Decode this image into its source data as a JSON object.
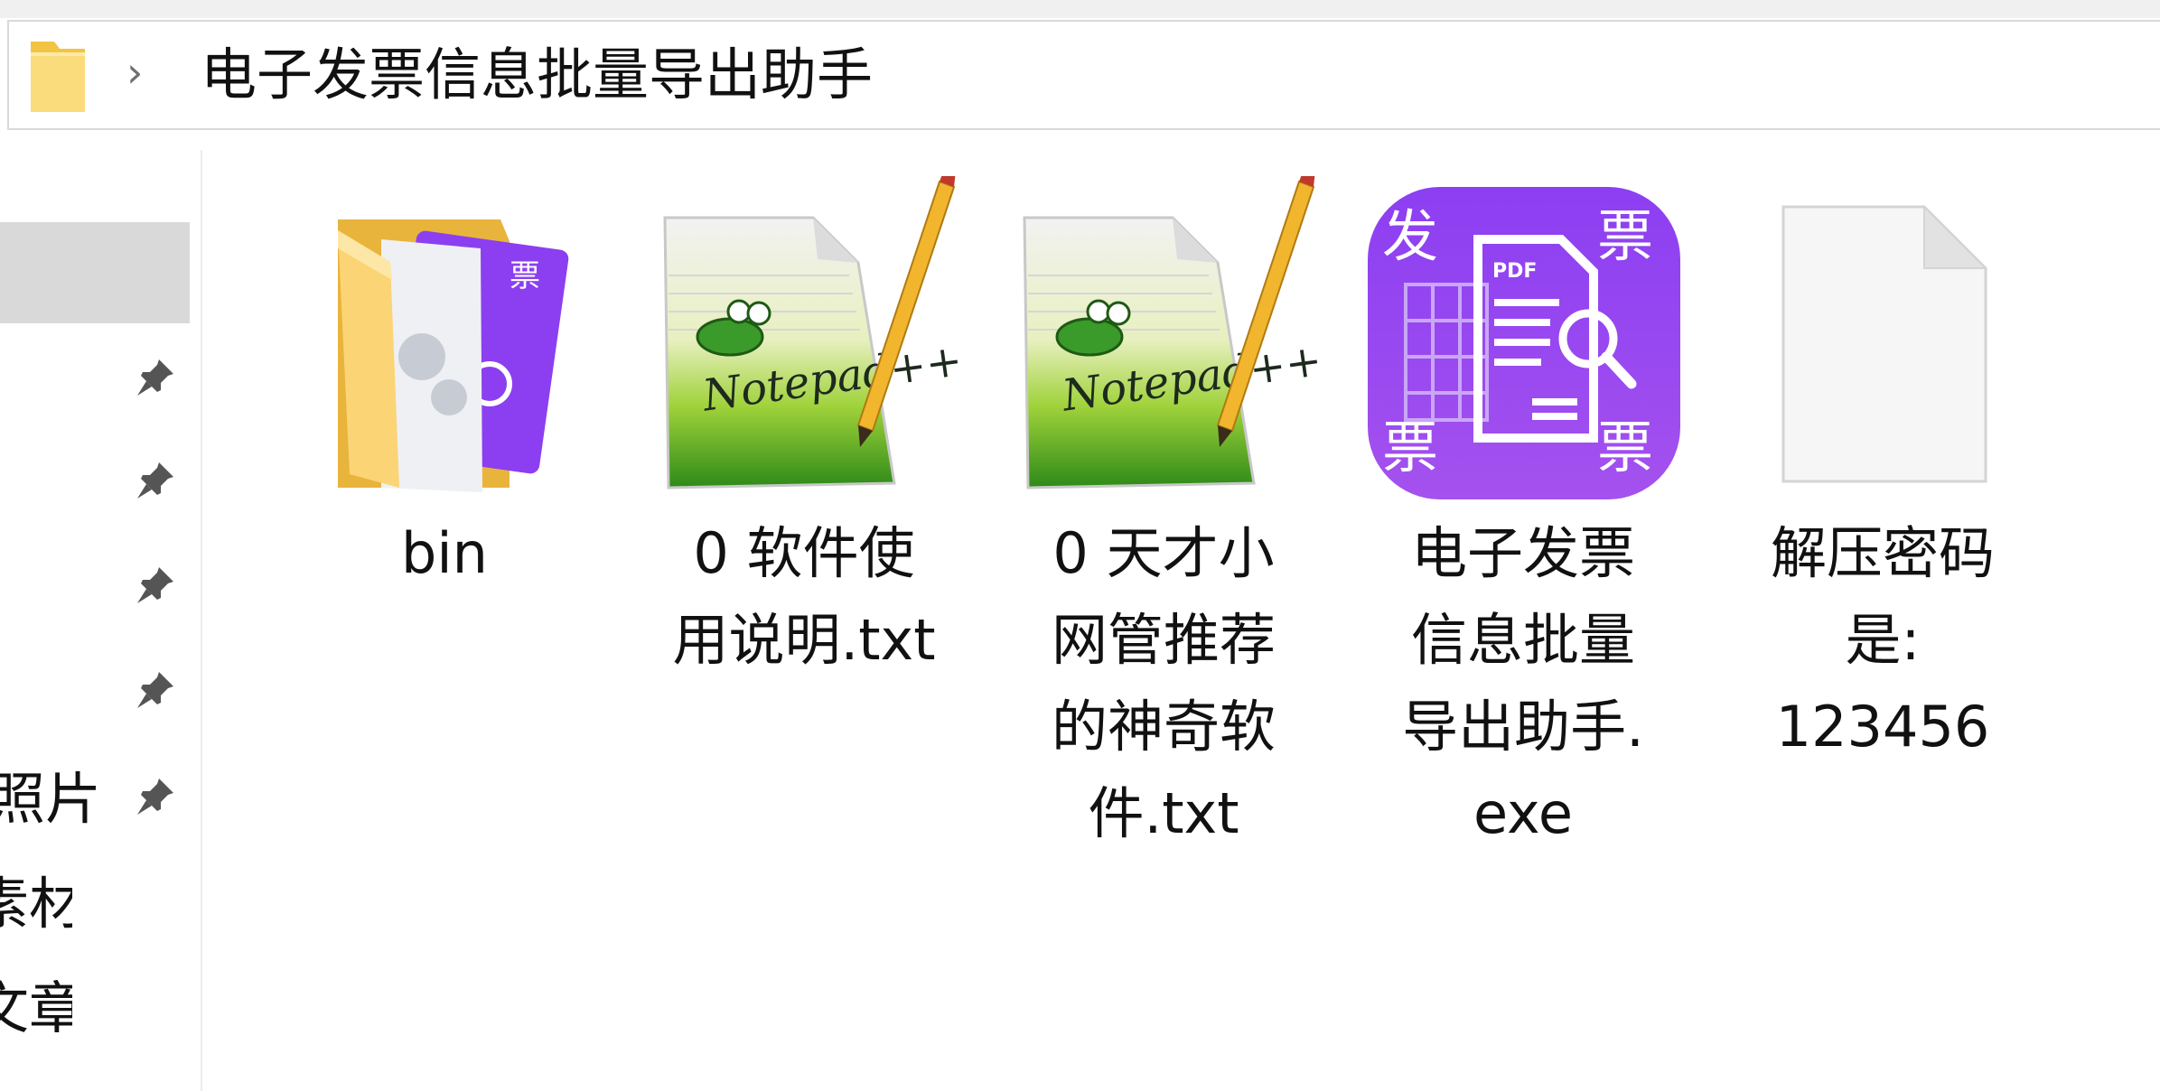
{
  "address_bar": {
    "path": "电子发票信息批量导出助手",
    "separator": "›"
  },
  "nav_pane": {
    "items": [
      {
        "label": "照片"
      },
      {
        "label": "素材"
      },
      {
        "label": "文章"
      }
    ]
  },
  "files": [
    {
      "name_line1": "bin",
      "name_line2": "",
      "name_line3": "",
      "name_line4": "",
      "icon": "folder-icon"
    },
    {
      "name_line1": "0 软件使",
      "name_line2": "用说明.txt",
      "name_line3": "",
      "name_line4": "",
      "icon": "notepad-plus-plus-icon"
    },
    {
      "name_line1": "0 天才小",
      "name_line2": "网管推荐",
      "name_line3": "的神奇软",
      "name_line4": "件.txt",
      "icon": "notepad-plus-plus-icon"
    },
    {
      "name_line1": "电子发票",
      "name_line2": "信息批量",
      "name_line3": "导出助手.",
      "name_line4": "exe",
      "icon": "invoice-app-icon"
    },
    {
      "name_line1": "解压密码",
      "name_line2": "是:",
      "name_line3": "123456",
      "name_line4": "",
      "icon": "blank-file-icon"
    }
  ],
  "invoice_icon_glyphs": {
    "top_left": "发",
    "top_right": "票",
    "bottom_left": "票",
    "bottom_right": "票",
    "pdf": "PDF"
  },
  "colors": {
    "folder_yellow": "#f8d775",
    "invoice_purple": "#8a3ff0",
    "selection_gray": "#d9d9d9"
  }
}
